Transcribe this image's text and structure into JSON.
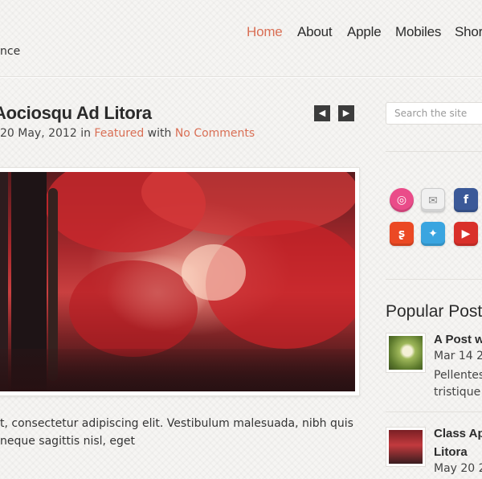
{
  "nav": {
    "items": [
      {
        "label": "Home",
        "active": true
      },
      {
        "label": "About"
      },
      {
        "label": "Apple"
      },
      {
        "label": "Mobiles"
      },
      {
        "label": "Short"
      }
    ],
    "active_color": "#d96f55"
  },
  "tagline": "nce",
  "post": {
    "title": "Aociosqu Ad Litora",
    "date": "20 May, 2012",
    "in_word": "in",
    "category": "Featured",
    "with_word": "with",
    "comments": "No Comments",
    "prev_icon": "chevron-left-icon",
    "next_icon": "chevron-right-icon",
    "excerpt_line1": "t, consectetur adipiscing elit. Vestibulum malesuada, nibh quis",
    "excerpt_line2": "neque sagittis nisl, eget"
  },
  "sidebar": {
    "search_placeholder": "Search the site",
    "social": [
      {
        "name": "dribbble-icon",
        "color": "#ea4c89"
      },
      {
        "name": "email-icon",
        "color": "#e6e6e6"
      },
      {
        "name": "facebook-icon",
        "color": "#3b5998"
      },
      {
        "name": "stumbleupon-icon",
        "color": "#eb4924"
      },
      {
        "name": "twitter-icon",
        "color": "#3aa5e0"
      },
      {
        "name": "youtube-icon",
        "color": "#d9302a"
      }
    ],
    "popular_title": "Popular Posts",
    "popular": [
      {
        "title": "A Post wi",
        "date": "Mar 14 2",
        "text_line1": "Pellentes",
        "text_line2": "tristique"
      },
      {
        "title": "Class Apt",
        "title_line2": "Litora",
        "date": "May 20 2"
      }
    ]
  }
}
